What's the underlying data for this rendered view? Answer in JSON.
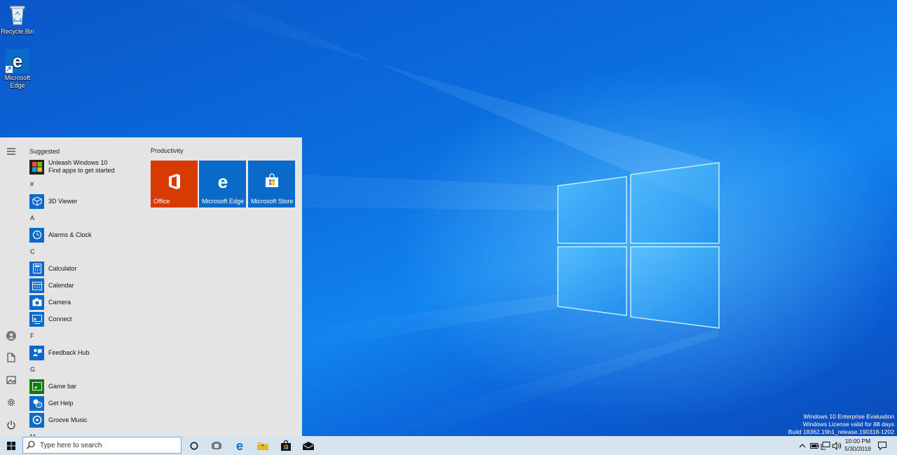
{
  "desktop": {
    "icons": [
      {
        "label": "Recycle Bin"
      },
      {
        "label": "Microsoft Edge"
      }
    ],
    "watermark": {
      "line1": "Windows 10 Enterprise Evaluation",
      "line2": "Windows License valid for 88 days",
      "line3": "Build 18362.19h1_release.190318-1202"
    }
  },
  "start_menu": {
    "suggested_heading": "Suggested",
    "suggested": {
      "title": "Unleash Windows 10",
      "subtitle": "Find apps to get started"
    },
    "sections": [
      {
        "letter": "#",
        "apps": [
          "3D Viewer"
        ]
      },
      {
        "letter": "A",
        "apps": [
          "Alarms & Clock"
        ]
      },
      {
        "letter": "C",
        "apps": [
          "Calculator",
          "Calendar",
          "Camera",
          "Connect"
        ]
      },
      {
        "letter": "F",
        "apps": [
          "Feedback Hub"
        ]
      },
      {
        "letter": "G",
        "apps": [
          "Game bar",
          "Get Help",
          "Groove Music"
        ]
      },
      {
        "letter": "M",
        "apps": []
      }
    ],
    "tiles_heading": "Productivity",
    "tiles": [
      {
        "label": "Office",
        "color": "#d83b01"
      },
      {
        "label": "Microsoft Edge",
        "color": "#0a6ac9"
      },
      {
        "label": "Microsoft Store",
        "color": "#0a6ac9"
      }
    ]
  },
  "taskbar": {
    "search_placeholder": "Type here to search",
    "clock_time": "10:00 PM",
    "clock_date": "5/30/2019"
  },
  "colors": {
    "accent": "#0a6ac9",
    "office": "#d83b01",
    "start_bg": "#e4e4e4",
    "taskbar_bg": "#d6e4f0"
  }
}
